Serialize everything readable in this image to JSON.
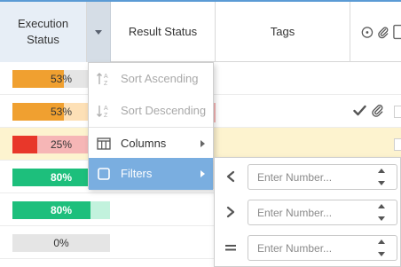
{
  "header": {
    "columns": {
      "execution_status": "Execution Status",
      "result_status": "Result Status",
      "tags": "Tags"
    },
    "icons": [
      "clock-icon",
      "paperclip-icon",
      "checkbox-icon"
    ]
  },
  "rows": [
    {
      "percent_label": "53%",
      "progress": 0.53,
      "fill_color": "#f0a030",
      "remainder_color": "#e5e5e5"
    },
    {
      "percent_label": "53%",
      "progress": 0.53,
      "fill_color": "#f0a030",
      "remainder_color": "#fde0b6",
      "actions": [
        "check-icon",
        "paperclip-icon"
      ]
    },
    {
      "percent_label": "25%",
      "progress": 0.25,
      "fill_color": "#e8372a",
      "remainder_color": "#f6b6b6",
      "highlighted": true
    },
    {
      "percent_label": "80%",
      "progress": 0.8,
      "fill_color": "#1dbf7c",
      "remainder_color": "#1dbf7c"
    },
    {
      "percent_label": "80%",
      "progress": 0.8,
      "fill_color": "#1dbf7c",
      "remainder_color": "#c2f2dd"
    },
    {
      "percent_label": "0%",
      "progress": 0.0,
      "fill_color": "#e5e5e5",
      "remainder_color": "#e5e5e5"
    }
  ],
  "column_menu": {
    "items": [
      {
        "label": "Sort Ascending",
        "icon": "sort-ascending-icon",
        "disabled": true
      },
      {
        "label": "Sort Descending",
        "icon": "sort-descending-icon",
        "disabled": true
      },
      {
        "label": "Columns",
        "icon": "columns-icon",
        "submenu": true
      },
      {
        "label": "Filters",
        "icon": "filter-icon",
        "submenu": true,
        "active": true
      }
    ]
  },
  "filters": {
    "rows": [
      {
        "operator": "less-than-icon",
        "placeholder": "Enter Number..."
      },
      {
        "operator": "greater-than-icon",
        "placeholder": "Enter Number..."
      },
      {
        "operator": "equals-icon",
        "placeholder": "Enter Number..."
      }
    ]
  },
  "colors": {
    "accent": "#5b9bd5",
    "menu_active": "#7aaee0",
    "row_highlight": "#fdf3cf",
    "orange": "#f0a030",
    "red": "#e8372a",
    "green": "#1dbf7c"
  }
}
